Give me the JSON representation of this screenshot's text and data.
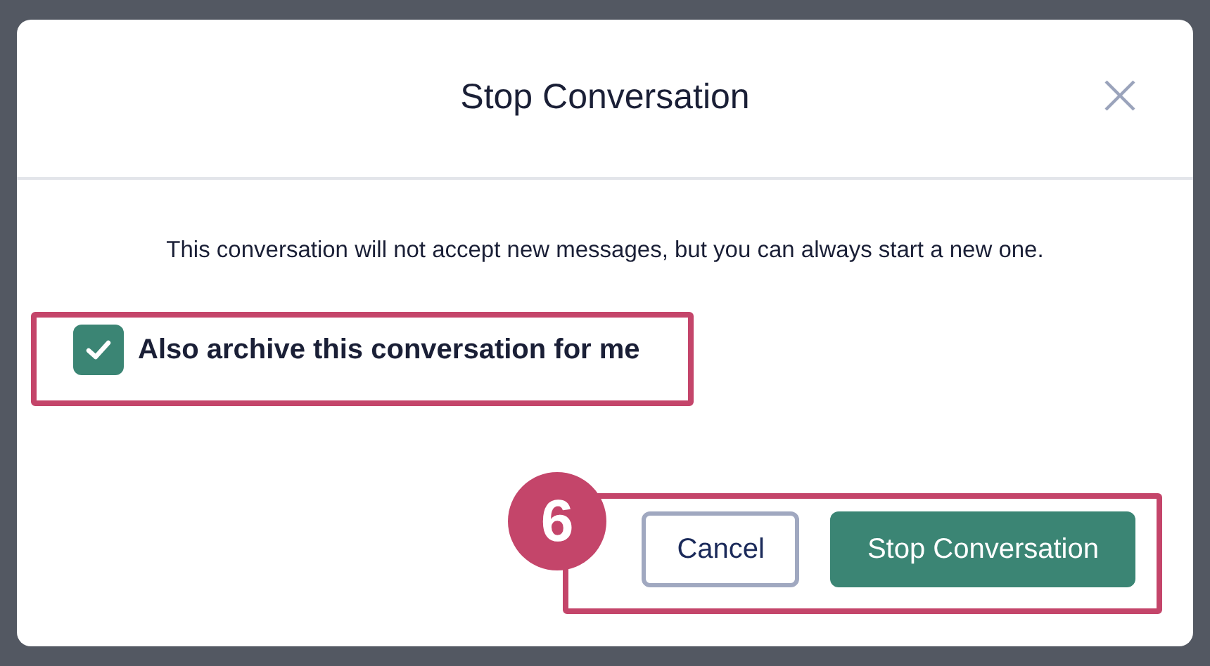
{
  "dialog": {
    "title": "Stop Conversation",
    "description": "This conversation will not accept new messages, but you can always start a new one.",
    "checkbox": {
      "label": "Also archive this conversation for me",
      "checked": true
    },
    "buttons": [
      {
        "label": "Cancel",
        "kind": "secondary"
      },
      {
        "label": "Stop Conversation",
        "kind": "primary"
      }
    ]
  },
  "annotations": [
    {
      "kind": "checkbox_frame"
    },
    {
      "kind": "buttons_frame",
      "badge": "6"
    }
  ]
}
